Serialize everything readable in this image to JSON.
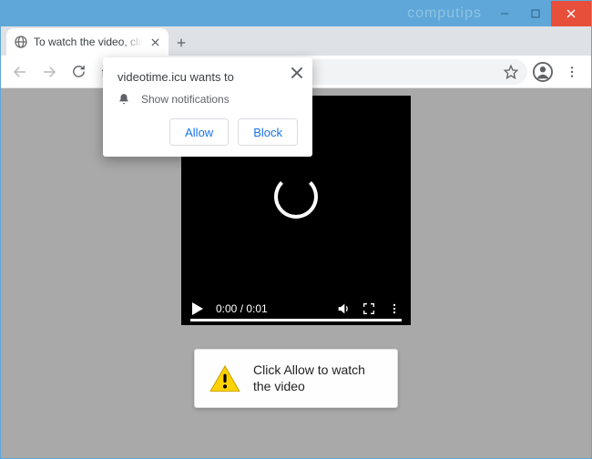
{
  "window": {
    "watermark": "computips"
  },
  "browser": {
    "tab_title": "To watch the video, click the Allo",
    "url_host": "videotime.icu",
    "url_path": "/"
  },
  "permission": {
    "origin_text": "videotime.icu wants to",
    "capability_label": "Show notifications",
    "allow_label": "Allow",
    "block_label": "Block"
  },
  "video": {
    "time_text": "0:00 / 0:01"
  },
  "page_prompt": {
    "message": "Click Allow to watch the video"
  }
}
